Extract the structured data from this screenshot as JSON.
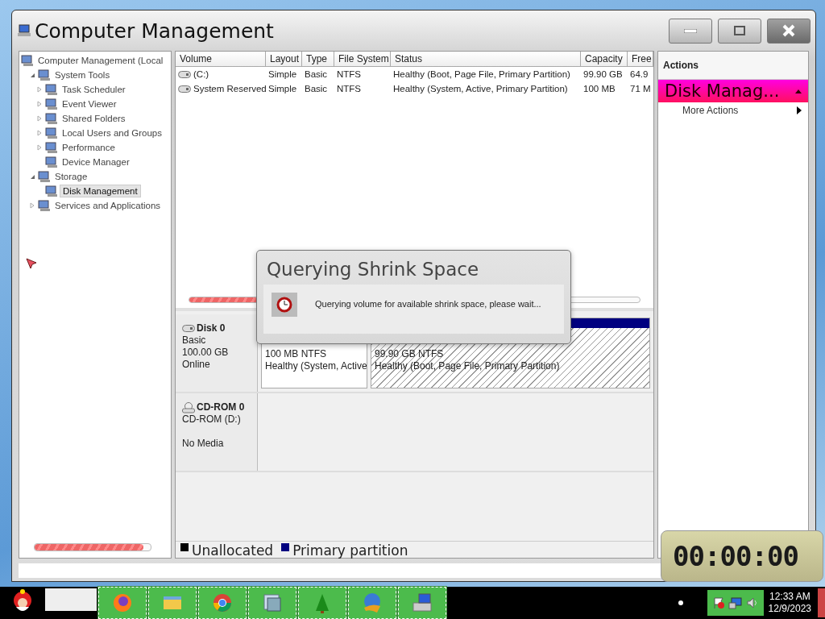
{
  "window": {
    "title": "Computer Management"
  },
  "tree": [
    {
      "label": "Computer Management (Local",
      "selected": false,
      "children": [
        {
          "label": "System Tools",
          "expanded": true,
          "selected": false,
          "children": [
            {
              "label": "Task Scheduler",
              "expanded": false,
              "selected": false
            },
            {
              "label": "Event Viewer",
              "expanded": false,
              "selected": false
            },
            {
              "label": "Shared Folders",
              "expanded": false,
              "selected": false
            },
            {
              "label": "Local Users and Groups",
              "expanded": false,
              "selected": false
            },
            {
              "label": "Performance",
              "expanded": false,
              "selected": false
            },
            {
              "label": "Device Manager",
              "selected": false
            }
          ]
        },
        {
          "label": "Storage",
          "expanded": true,
          "selected": false,
          "children": [
            {
              "label": "Disk Management",
              "selected": true
            }
          ]
        },
        {
          "label": "Services and Applications",
          "expanded": false,
          "selected": false
        }
      ]
    }
  ],
  "volumes": {
    "columns": [
      "Volume",
      "Layout",
      "Type",
      "File System",
      "Status",
      "Capacity",
      "Free"
    ],
    "rows": [
      {
        "cells": [
          "(C:)",
          "Simple",
          "Basic",
          "NTFS",
          "Healthy (Boot, Page File, Primary Partition)",
          "99.90 GB",
          "64.9"
        ]
      },
      {
        "cells": [
          "System Reserved",
          "Simple",
          "Basic",
          "NTFS",
          "Healthy (System, Active, Primary Partition)",
          "100 MB",
          "71 M"
        ]
      }
    ]
  },
  "disks": [
    {
      "kind": "disk",
      "name": "Disk 0",
      "lines": [
        "Basic",
        "100.00 GB",
        "Online"
      ],
      "partitions": [
        {
          "size": "100 MB NTFS",
          "status": "Healthy (System, Active",
          "hatched": false
        },
        {
          "size": "99.90 GB NTFS",
          "status": "Healthy (Boot, Page File, Primary Partition)",
          "hatched": true
        }
      ]
    },
    {
      "kind": "cdrom",
      "name": "CD-ROM 0",
      "lines": [
        "CD-ROM (D:)",
        "No Media"
      ]
    }
  ],
  "legend": [
    {
      "label": "Unallocated",
      "color": "#000000"
    },
    {
      "label": "Primary partition",
      "color": "#000080"
    }
  ],
  "actions": {
    "title": "Actions",
    "section": "Disk Manag...",
    "items": [
      "More Actions"
    ]
  },
  "dialog": {
    "title": "Querying Shrink Space",
    "message": "Querying volume for available shrink space, please wait..."
  },
  "timer": {
    "display": "00:00:00"
  },
  "taskbar": {
    "time": "12:33 AM",
    "date": "12/9/2023"
  }
}
